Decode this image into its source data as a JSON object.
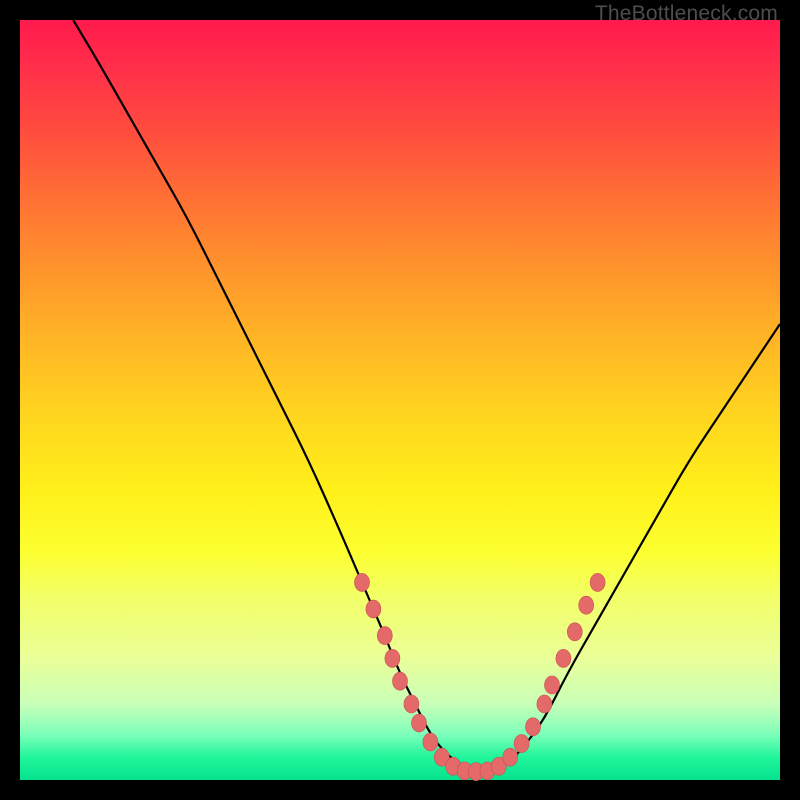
{
  "watermark": "TheBottleneck.com",
  "colors": {
    "background": "#000000",
    "curve_stroke": "#000000",
    "marker_fill": "#e46a6a",
    "marker_stroke": "#c94f4f"
  },
  "chart_data": {
    "type": "line",
    "title": "",
    "xlabel": "",
    "ylabel": "",
    "xlim": [
      0,
      100
    ],
    "ylim": [
      0,
      100
    ],
    "grid": false,
    "legend": false,
    "series": [
      {
        "name": "curve",
        "x": [
          7,
          10,
          14,
          18,
          22,
          26,
          30,
          34,
          38,
          42,
          45,
          48,
          50,
          52,
          54,
          56,
          58,
          60,
          62,
          64,
          66,
          69,
          72,
          76,
          80,
          84,
          88,
          92,
          96,
          100
        ],
        "y": [
          100,
          95,
          88,
          81,
          74,
          66,
          58,
          50,
          42,
          33,
          26,
          19,
          14,
          10,
          6,
          3.5,
          2,
          1.2,
          1.2,
          2,
          4,
          8,
          14,
          21,
          28,
          35,
          42,
          48,
          54,
          60
        ]
      }
    ],
    "markers": [
      {
        "x": 45,
        "y": 26
      },
      {
        "x": 46.5,
        "y": 22.5
      },
      {
        "x": 48,
        "y": 19
      },
      {
        "x": 49,
        "y": 16
      },
      {
        "x": 50,
        "y": 13
      },
      {
        "x": 51.5,
        "y": 10
      },
      {
        "x": 52.5,
        "y": 7.5
      },
      {
        "x": 54,
        "y": 5
      },
      {
        "x": 55.5,
        "y": 3
      },
      {
        "x": 57,
        "y": 1.8
      },
      {
        "x": 58.5,
        "y": 1.2
      },
      {
        "x": 60,
        "y": 1.1
      },
      {
        "x": 61.5,
        "y": 1.2
      },
      {
        "x": 63,
        "y": 1.8
      },
      {
        "x": 64.5,
        "y": 3
      },
      {
        "x": 66,
        "y": 4.8
      },
      {
        "x": 67.5,
        "y": 7
      },
      {
        "x": 69,
        "y": 10
      },
      {
        "x": 70,
        "y": 12.5
      },
      {
        "x": 71.5,
        "y": 16
      },
      {
        "x": 73,
        "y": 19.5
      },
      {
        "x": 74.5,
        "y": 23
      },
      {
        "x": 76,
        "y": 26
      }
    ]
  }
}
